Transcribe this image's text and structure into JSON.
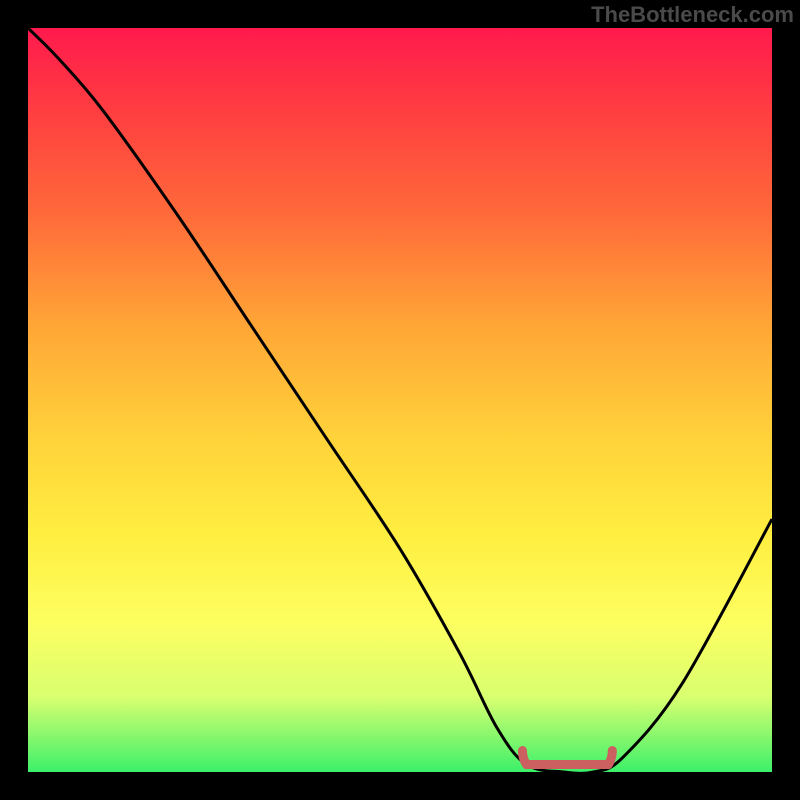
{
  "brand": "TheBottleneck.com",
  "colors": {
    "frame": "#000000",
    "curve": "#000000",
    "marker": "#cc6060",
    "gradient_top": "#ff1a4d",
    "gradient_bottom": "#3cf06a"
  },
  "chart_data": {
    "type": "line",
    "title": "",
    "xlabel": "",
    "ylabel": "",
    "xlim": [
      0,
      100
    ],
    "ylim": [
      0,
      100
    ],
    "series": [
      {
        "name": "bottleneck-curve",
        "x": [
          0,
          4,
          10,
          20,
          30,
          40,
          50,
          58,
          63,
          67,
          72,
          76,
          80,
          88,
          100
        ],
        "values": [
          100,
          96,
          89,
          75,
          60,
          45,
          30,
          16,
          6,
          1,
          0,
          0,
          2,
          12,
          34
        ]
      }
    ],
    "annotations": [
      {
        "name": "flat-minimum-marker",
        "x_start": 67,
        "x_end": 78,
        "y": 1
      }
    ]
  }
}
